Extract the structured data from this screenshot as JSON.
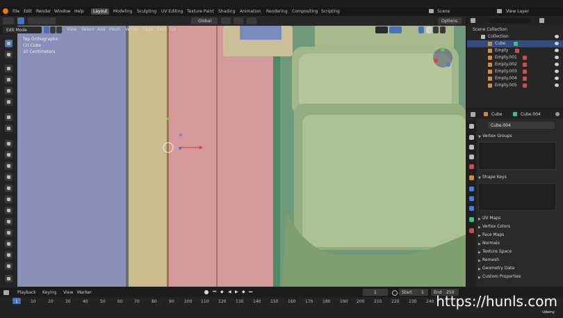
{
  "menu": {
    "items": [
      "File",
      "Edit",
      "Render",
      "Window",
      "Help"
    ],
    "workspaces": [
      "Layout",
      "Modeling",
      "Sculpting",
      "UV Editing",
      "Texture Paint",
      "Shading",
      "Animation",
      "Rendering",
      "Compositing",
      "Scripting"
    ],
    "active_workspace": "Layout",
    "scene": "Scene",
    "view_layer": "View Layer"
  },
  "header": {
    "mode": "Edit Mode",
    "menus": [
      "View",
      "Select",
      "Add",
      "Mesh",
      "Vertex",
      "Edge",
      "Face",
      "UV"
    ],
    "transform": "Global",
    "options": "Options"
  },
  "viewport": {
    "view_name": "Top Orthographic",
    "object_info": "(1) Cube",
    "scale": "10 Centimeters"
  },
  "outliner": {
    "rows": [
      {
        "label": "Scene Collection",
        "type": "scene"
      },
      {
        "label": "Collection",
        "type": "collection"
      },
      {
        "label": "Cube",
        "type": "mesh",
        "selected": true
      },
      {
        "label": "Empty",
        "type": "empty"
      },
      {
        "label": "Empty.001",
        "type": "empty"
      },
      {
        "label": "Empty.002",
        "type": "empty"
      },
      {
        "label": "Empty.003",
        "type": "empty"
      },
      {
        "label": "Empty.004",
        "type": "empty"
      },
      {
        "label": "Empty.005",
        "type": "empty"
      }
    ]
  },
  "properties": {
    "object": "Cube",
    "mesh": "Cube.004",
    "data_name": "Cube.004",
    "sections": {
      "vertex_groups": "Vertex Groups",
      "shape_keys": "Shape Keys"
    },
    "collapsed": [
      "UV Maps",
      "Vertex Colors",
      "Face Maps",
      "Normals",
      "Texture Space",
      "Remesh",
      "Geometry Data",
      "Custom Properties"
    ]
  },
  "timeline": {
    "menus": [
      "Playback",
      "Keying",
      "View",
      "Marker"
    ],
    "current_frame": "1",
    "start_label": "Start",
    "start": "1",
    "end_label": "End",
    "end": "250",
    "ticks": [
      "1",
      "10",
      "20",
      "30",
      "40",
      "50",
      "60",
      "70",
      "80",
      "90",
      "100",
      "110",
      "120",
      "130",
      "140",
      "150",
      "160",
      "170",
      "180",
      "190",
      "200",
      "210",
      "220",
      "230",
      "240"
    ]
  },
  "watermark": "https://hunls.com",
  "brand": "Udemy"
}
